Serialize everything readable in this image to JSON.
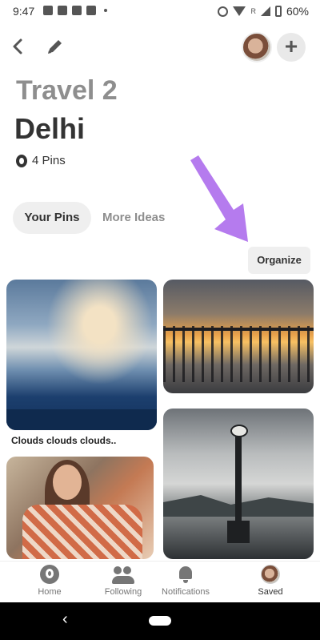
{
  "status_bar": {
    "time": "9:47",
    "signal_badge": "R",
    "battery": "60%"
  },
  "header": {
    "back_icon": "chevron-left-icon",
    "edit_icon": "pencil-icon",
    "add_icon": "plus-icon",
    "add_label": "+"
  },
  "board": {
    "title": "Travel 2",
    "section": "Delhi",
    "pin_count": "4 Pins"
  },
  "tabs": [
    {
      "label": "Your Pins",
      "active": true
    },
    {
      "label": "More Ideas",
      "active": false
    }
  ],
  "organize_label": "Organize",
  "annotation_arrow_color": "#b57bee",
  "pins": [
    {
      "caption": "Clouds clouds clouds.."
    }
  ],
  "bottom_nav": [
    {
      "label": "Home",
      "icon": "pinterest-icon"
    },
    {
      "label": "Following",
      "icon": "people-icon"
    },
    {
      "label": "Notifications",
      "icon": "bell-icon"
    },
    {
      "label": "Saved",
      "icon": "avatar-icon",
      "active": true
    }
  ],
  "system_nav": {
    "back_label": "‹"
  }
}
